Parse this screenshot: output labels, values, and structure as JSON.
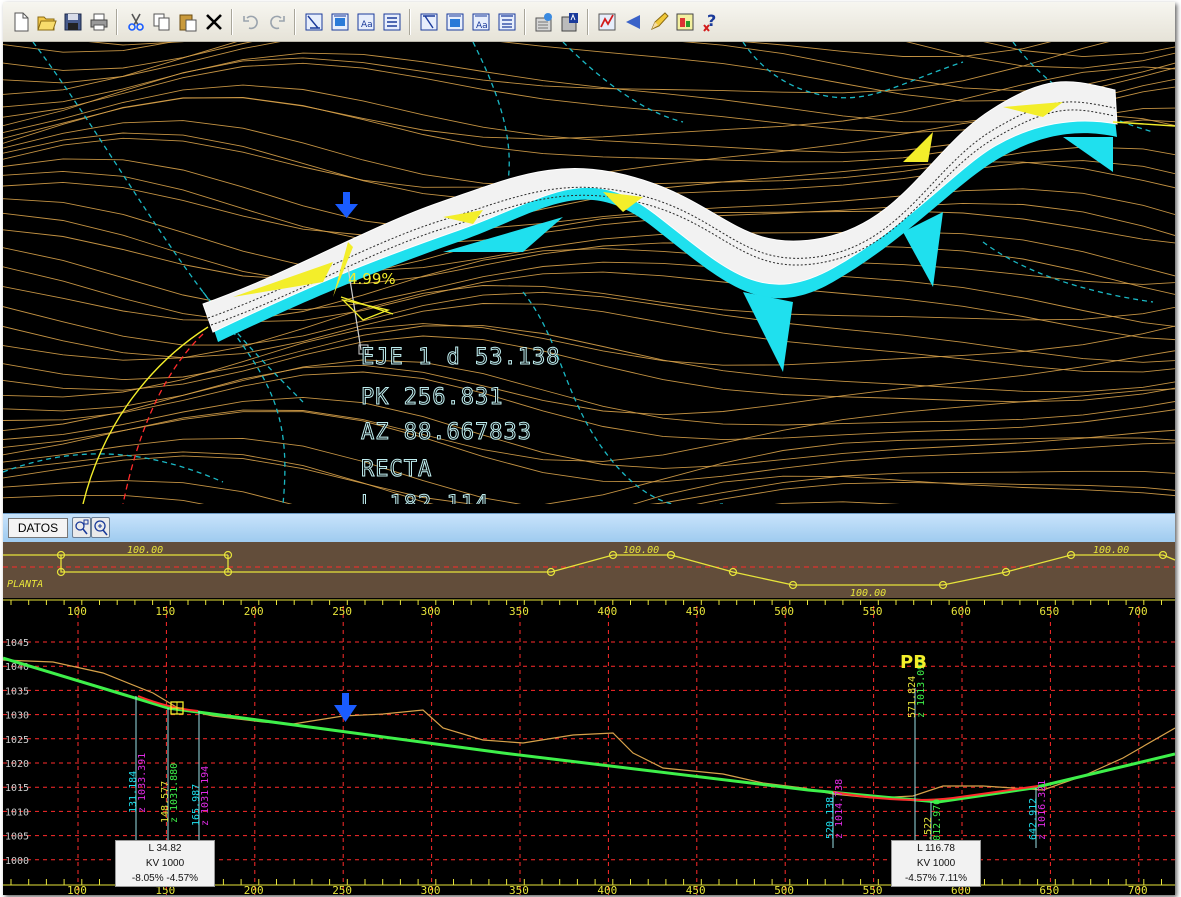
{
  "colors": {
    "contour": "#d8a24a",
    "dashed_cyan": "#1ab8c4",
    "road_white": "#ffffff",
    "slope_yellow": "#f3ee2a",
    "slope_cyan": "#1fe0ee",
    "grade_green": "#3ef04a",
    "red_guide": "#ff2b2b",
    "axis_yellow": "#e7e43a",
    "marker_blue": "#1a5cff"
  },
  "toolbar": {
    "buttons": [
      "new-icon",
      "open-icon",
      "save-icon",
      "print-icon",
      "cut-icon",
      "copy-icon",
      "paste-icon",
      "delete-icon",
      "undo-icon",
      "redo-icon",
      "view-plan-1-icon",
      "view-plan-2-icon",
      "view-plan-3-icon",
      "view-plan-4-icon",
      "view-profile-1-icon",
      "view-profile-2-icon",
      "view-profile-3-icon",
      "view-profile-4-icon",
      "properties-icon",
      "report-icon",
      "profile-chart-icon",
      "perspective-icon",
      "pencil-icon",
      "export-icon",
      "help-icon"
    ]
  },
  "plan": {
    "grade_label": "4.99%",
    "info": {
      "line1": "EJE 1 d 53.138",
      "line2": "PK  256.831",
      "line3": "AZ  88.667833",
      "line4": "RECTA",
      "line5": "L  182.114"
    }
  },
  "datos_tab": "DATOS",
  "planta_strip": {
    "label": "PLANTA",
    "radius_labels": [
      "100.00",
      "100.00",
      "100.00",
      "100.00"
    ]
  },
  "profile": {
    "x_ticks": [
      "100",
      "150",
      "200",
      "250",
      "300",
      "350",
      "400",
      "450",
      "500",
      "550",
      "600",
      "650",
      "700"
    ],
    "y_ticks": [
      "1045",
      "1040",
      "1035",
      "1030",
      "1025",
      "1020",
      "1015",
      "1010",
      "1005",
      "1000"
    ],
    "vertical_labels": [
      "131.184",
      "z 1033.391",
      "148.577",
      "z 1031.880",
      "165.987",
      "z 1031.194",
      "571.824",
      "z 1013.094",
      "520.138",
      "z 1014.738",
      "584.522",
      "z 1012.970",
      "642.912",
      "z 1016.321"
    ],
    "pb_label": "PB",
    "kv_boxes": [
      {
        "l": "L 34.82",
        "kv": "KV 1000",
        "grades": "-8.05% -4.57%"
      },
      {
        "l": "L 116.78",
        "kv": "KV 1000",
        "grades": "-4.57% 7.11%"
      }
    ]
  }
}
